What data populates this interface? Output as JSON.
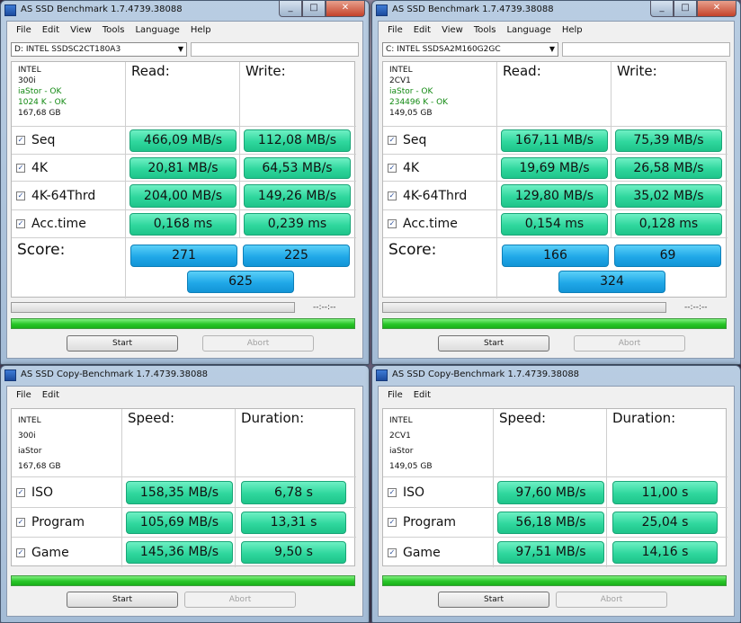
{
  "colors": {
    "value_bg": "#2fd79d",
    "score_bg": "#20a8e8",
    "progress_fill": "#29c629",
    "ok_text": "#138a13"
  },
  "benchmark": [
    {
      "title": "AS SSD Benchmark 1.7.4739.38088",
      "menu": [
        "File",
        "Edit",
        "View",
        "Tools",
        "Language",
        "Help"
      ],
      "drive": "D: INTEL SSDSC2CT180A3",
      "info": {
        "line1": "INTEL",
        "line2": "300i",
        "driver": "iaStor - OK",
        "align": "1024 K - OK",
        "size": "167,68 GB"
      },
      "read_label": "Read:",
      "write_label": "Write:",
      "rows": [
        {
          "label": "Seq",
          "read": "466,09 MB/s",
          "write": "112,08 MB/s"
        },
        {
          "label": "4K",
          "read": "20,81 MB/s",
          "write": "64,53 MB/s"
        },
        {
          "label": "4K-64Thrd",
          "read": "204,00 MB/s",
          "write": "149,26 MB/s"
        },
        {
          "label": "Acc.time",
          "read": "0,168 ms",
          "write": "0,239 ms"
        }
      ],
      "score_label": "Score:",
      "score": {
        "read": "271",
        "write": "225",
        "total": "625"
      },
      "time_readout": "--:--:--",
      "start": "Start",
      "abort": "Abort",
      "progress_top": 0,
      "progress_bottom": 1.0
    },
    {
      "title": "AS SSD Benchmark 1.7.4739.38088",
      "menu": [
        "File",
        "Edit",
        "View",
        "Tools",
        "Language",
        "Help"
      ],
      "drive": "C: INTEL SSDSA2M160G2GC",
      "info": {
        "line1": "INTEL",
        "line2": "2CV1",
        "driver": "iaStor - OK",
        "align": "234496 K - OK",
        "size": "149,05 GB"
      },
      "read_label": "Read:",
      "write_label": "Write:",
      "rows": [
        {
          "label": "Seq",
          "read": "167,11 MB/s",
          "write": "75,39 MB/s"
        },
        {
          "label": "4K",
          "read": "19,69 MB/s",
          "write": "26,58 MB/s"
        },
        {
          "label": "4K-64Thrd",
          "read": "129,80 MB/s",
          "write": "35,02 MB/s"
        },
        {
          "label": "Acc.time",
          "read": "0,154 ms",
          "write": "0,128 ms"
        }
      ],
      "score_label": "Score:",
      "score": {
        "read": "166",
        "write": "69",
        "total": "324"
      },
      "time_readout": "--:--:--",
      "start": "Start",
      "abort": "Abort",
      "progress_top": 0,
      "progress_bottom": 1.0
    }
  ],
  "copy": [
    {
      "title": "AS SSD Copy-Benchmark 1.7.4739.38088",
      "menu": [
        "File",
        "Edit"
      ],
      "info": {
        "line1": "INTEL",
        "line2": "300i",
        "driver": "iaStor",
        "size": "167,68 GB"
      },
      "speed_label": "Speed:",
      "duration_label": "Duration:",
      "rows": [
        {
          "label": "ISO",
          "speed": "158,35 MB/s",
          "duration": "6,78 s"
        },
        {
          "label": "Program",
          "speed": "105,69 MB/s",
          "duration": "13,31 s"
        },
        {
          "label": "Game",
          "speed": "145,36 MB/s",
          "duration": "9,50 s"
        }
      ],
      "start": "Start",
      "abort": "Abort",
      "progress": 1.0
    },
    {
      "title": "AS SSD Copy-Benchmark 1.7.4739.38088",
      "menu": [
        "File",
        "Edit"
      ],
      "info": {
        "line1": "INTEL",
        "line2": "2CV1",
        "driver": "iaStor",
        "size": "149,05 GB"
      },
      "speed_label": "Speed:",
      "duration_label": "Duration:",
      "rows": [
        {
          "label": "ISO",
          "speed": "97,60 MB/s",
          "duration": "11,00 s"
        },
        {
          "label": "Program",
          "speed": "56,18 MB/s",
          "duration": "25,04 s"
        },
        {
          "label": "Game",
          "speed": "97,51 MB/s",
          "duration": "14,16 s"
        }
      ],
      "start": "Start",
      "abort": "Abort",
      "progress": 1.0
    }
  ]
}
